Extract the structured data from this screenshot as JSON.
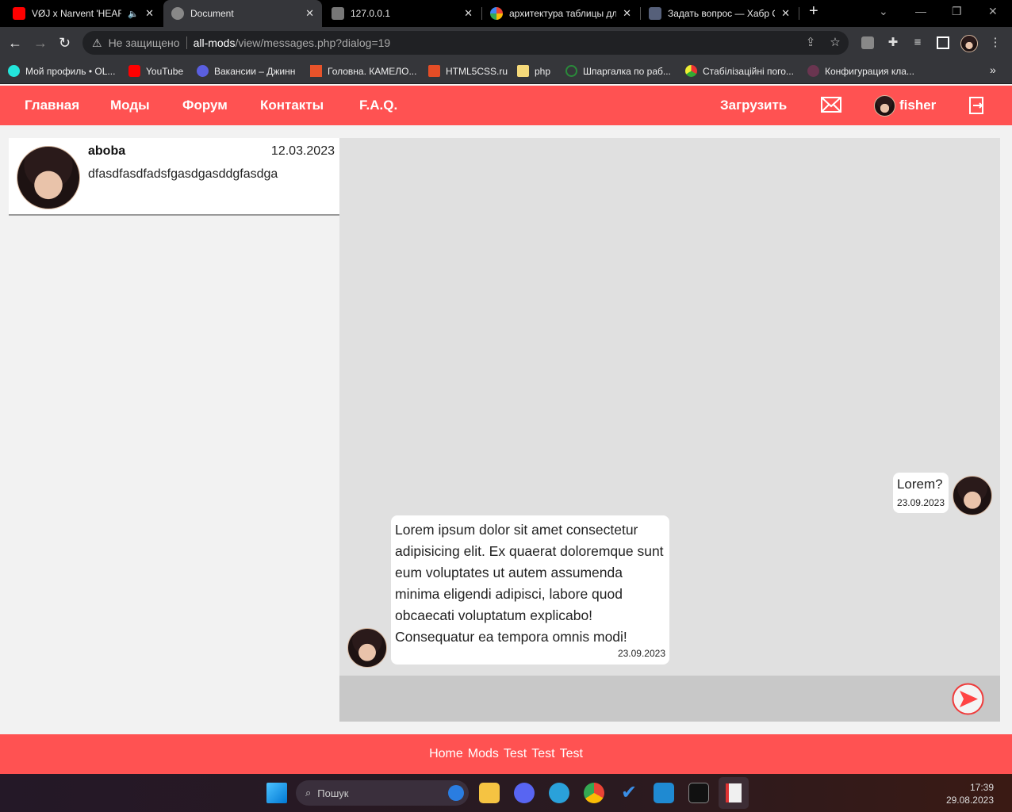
{
  "browser": {
    "tabs": [
      {
        "title": "VØJ x Narvent 'HEAR",
        "icon": "youtube-icon",
        "audio": true
      },
      {
        "title": "Document",
        "icon": "globe-icon",
        "active": true
      },
      {
        "title": "127.0.0.1",
        "icon": "site-icon"
      },
      {
        "title": "архитектура таблицы для",
        "icon": "google-icon"
      },
      {
        "title": "Задать вопрос — Хабр Q",
        "icon": "habr-icon"
      }
    ],
    "security": "Не защищено",
    "url_host": "all-mods",
    "url_path": "/view/messages.php?dialog=19",
    "bookmarks": [
      "Мой профиль • OL...",
      "YouTube",
      "Вакансии – Джинн",
      "Головна. КАМЕЛО...",
      "HTML5CSS.ru",
      "php",
      "Шпаргалка по раб...",
      "Стабілізаційні пого...",
      "Конфигурация кла..."
    ]
  },
  "nav": {
    "links": [
      "Главная",
      "Моды",
      "Форум",
      "Контакты",
      "F.A.Q."
    ],
    "upload": "Загрузить",
    "username": "fisher",
    "accent": "#ff5252"
  },
  "dialogs": [
    {
      "name": "aboba",
      "date": "12.03.2023",
      "preview": "dfasdfasdfadsfgasdgasddgfasdga"
    }
  ],
  "messages": [
    {
      "side": "right",
      "text": "Lorem?",
      "date": "23.09.2023"
    },
    {
      "side": "left",
      "text": "Lorem ipsum dolor sit amet consectetur adipisicing elit. Ex quaerat doloremque sunt eum voluptates ut autem assumenda minima eligendi adipisci, labore quod obcaecati voluptatum explicabo! Consequatur ea tempora omnis modi!",
      "date": "23.09.2023"
    }
  ],
  "footer": {
    "links": [
      "Home",
      "Mods",
      "Test",
      "Test",
      "Test"
    ]
  },
  "taskbar": {
    "search": "Пошук",
    "time": "17:39",
    "date": "29.08.2023"
  }
}
